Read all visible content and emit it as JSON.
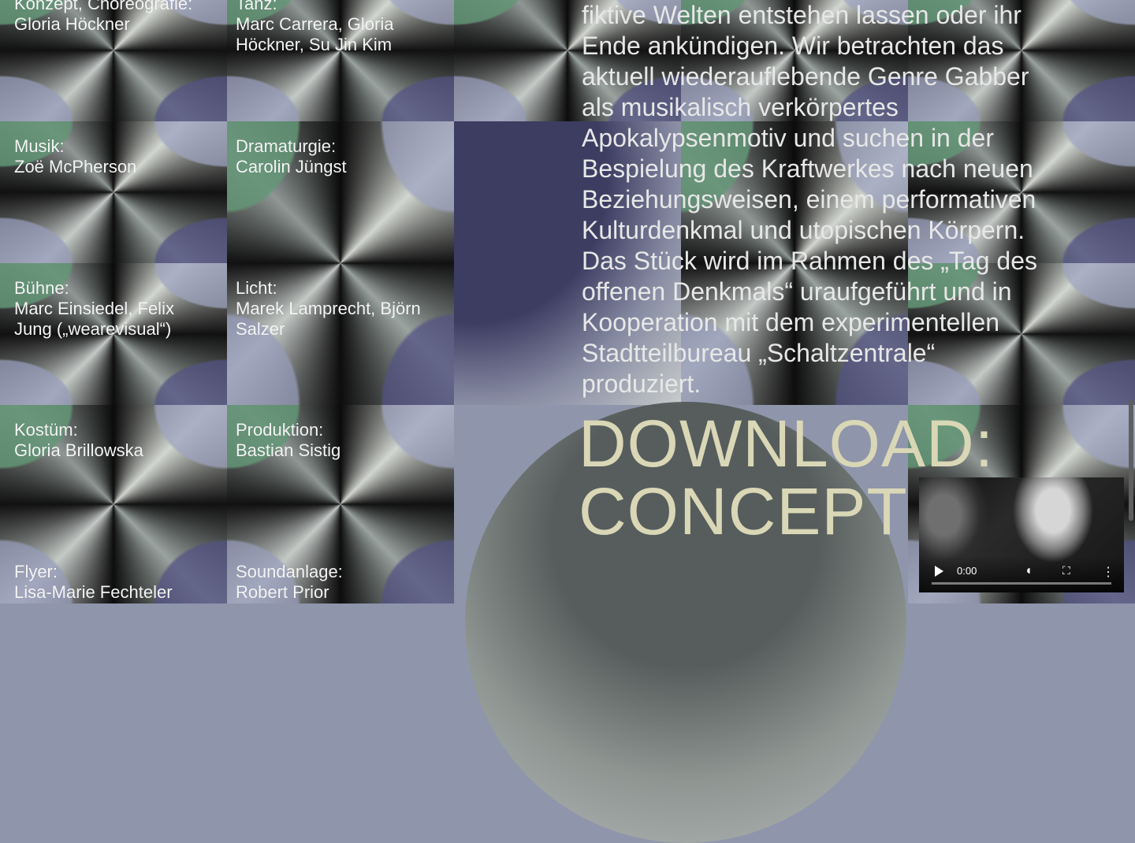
{
  "credits": [
    {
      "title": "Konzept, Choreografie:",
      "value": "Gloria Höckner"
    },
    {
      "title": "Tanz:",
      "value": "Marc Carrera, Gloria Höckner, Su Jin Kim"
    },
    {
      "title": "Musik:",
      "value": "Zoë McPherson"
    },
    {
      "title": "Dramaturgie:",
      "value": "Carolin Jüngst"
    },
    {
      "title": "Bühne:",
      "value": "Marc Einsiedel, Felix Jung („wearevisual“)"
    },
    {
      "title": "Licht:",
      "value": "Marek Lamprecht, Björn Salzer"
    },
    {
      "title": "Kostüm:",
      "value": "Gloria Brillowska"
    },
    {
      "title": "Produktion:",
      "value": "Bastian Sistig"
    },
    {
      "title": "Flyer:",
      "value": "Lisa-Marie Fechteler"
    },
    {
      "title": "Soundanlage:",
      "value": "Robert Prior"
    }
  ],
  "description_lines": [
    "fiktive Welten entstehen lassen oder ihr",
    "Ende ankündigen. Wir betrachten das",
    "aktuell wiederauflebende Genre Gabber",
    "als musikalisch verkörpertes",
    "Apokalypsenmotiv und suchen in der",
    "Bespielung des Kraftwerkes nach neuen",
    "Beziehungsweisen, einem performativen",
    "Kulturdenkmal und utopischen Körpern.",
    "Das Stück wird im Rahmen des „Tag des",
    "offenen Denkmals“ uraufgeführt und in",
    "Kooperation mit dem experimentellen",
    "Stadtteilbureau „Schaltzentrale“",
    "produziert."
  ],
  "download": {
    "line1": "DOWNLOAD:",
    "line2": "CONCEPT"
  },
  "video": {
    "time": "0:00"
  }
}
